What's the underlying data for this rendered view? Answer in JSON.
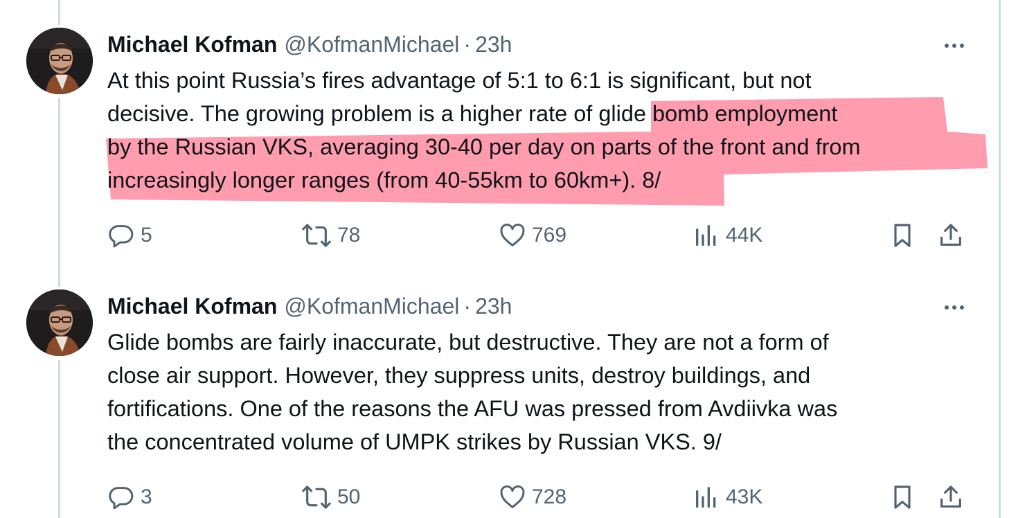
{
  "tweets": [
    {
      "name": "Michael Kofman",
      "handle": "@KofmanMichael",
      "separator": "·",
      "time": "23h",
      "lines": [
        "At this point Russia’s fires advantage of 5:1 to 6:1 is significant, but not",
        "decisive. The growing problem is a higher rate of glide bomb employment",
        "by the Russian VKS, averaging 30-40 per day on parts of the front and from",
        "increasingly longer ranges (from 40-55km to 60km+). 8/"
      ],
      "replies": "5",
      "reposts": "78",
      "likes": "769",
      "views": "44K"
    },
    {
      "name": "Michael Kofman",
      "handle": "@KofmanMichael",
      "separator": "·",
      "time": "23h",
      "lines": [
        "Glide bombs are fairly inaccurate, but destructive. They are not a form of",
        "close air support. However, they suppress units, destroy buildings, and",
        "fortifications. One of the reasons the AFU was pressed from Avdiivka was",
        "the concentrated volume of UMPK strikes by Russian VKS. 9/"
      ],
      "replies": "3",
      "reposts": "50",
      "likes": "728",
      "views": "43K"
    }
  ],
  "colors": {
    "text": "#0f1419",
    "secondary": "#536471",
    "highlight": "#ff4d6d",
    "thread_line": "#cfd9de"
  },
  "icons": [
    "reply-icon",
    "repost-icon",
    "like-icon",
    "views-icon",
    "bookmark-icon",
    "share-icon",
    "more-icon"
  ]
}
